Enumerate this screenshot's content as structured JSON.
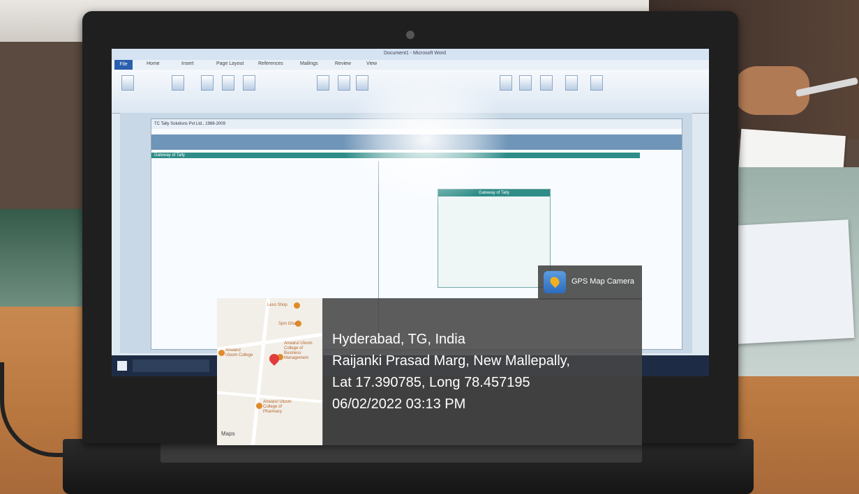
{
  "screen": {
    "window_title": "Document1 - Microsoft Word",
    "menu_items": [
      "File",
      "Home",
      "Insert",
      "Page Layout",
      "References",
      "Mailings",
      "Review",
      "View"
    ],
    "tally": {
      "top_line": "TC Tally Solutions Pvt Ltd., 1988-2009",
      "panel_title": "Gateway of Tally",
      "section_header": "Gateway of Tally"
    }
  },
  "gps": {
    "app_name": "GPS Map Camera",
    "city_line": "Hyderabad, TG, India",
    "address_line": "Raijanki Prasad Marg, New Mallepally,",
    "coords_line": "Lat 17.390785, Long 78.457195",
    "datetime_line": "06/02/2022 03:13 PM"
  },
  "map": {
    "labels": [
      "Lexo Shop",
      "Spin Ghar",
      "Anwarul Uloom College",
      "Anwarul Uloom College of Business Management",
      "Anwarul Uloom College of Pharmacy"
    ],
    "logo": "Maps"
  },
  "colors": {
    "overlay": "#464646",
    "pin": "#e23b3b",
    "taskbar": "#1d2c44",
    "tally_green": "#2f8d88"
  }
}
